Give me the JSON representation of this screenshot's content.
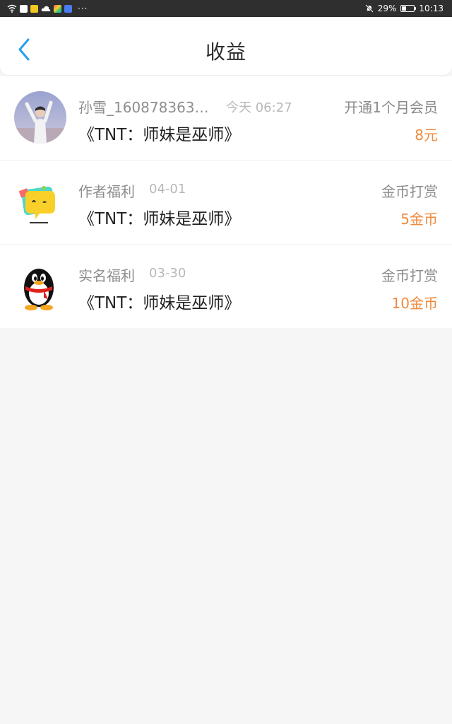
{
  "status_bar": {
    "battery": "29%",
    "time": "10:13",
    "dots": "···"
  },
  "header": {
    "title": "收益"
  },
  "items": [
    {
      "user": "孙雪_1608783630…",
      "time": "今天 06:27",
      "action": "开通1个月会员",
      "book": "《TNT：师妹是巫师》",
      "amount": "8元"
    },
    {
      "user": "作者福利",
      "time": "04-01",
      "action": "金币打赏",
      "book": "《TNT：师妹是巫师》",
      "amount": "5金币"
    },
    {
      "user": "实名福利",
      "time": "03-30",
      "action": "金币打赏",
      "book": "《TNT：师妹是巫师》",
      "amount": "10金币"
    }
  ],
  "colors": {
    "accent": "#2a9df4",
    "amount": "#f08a3c"
  }
}
